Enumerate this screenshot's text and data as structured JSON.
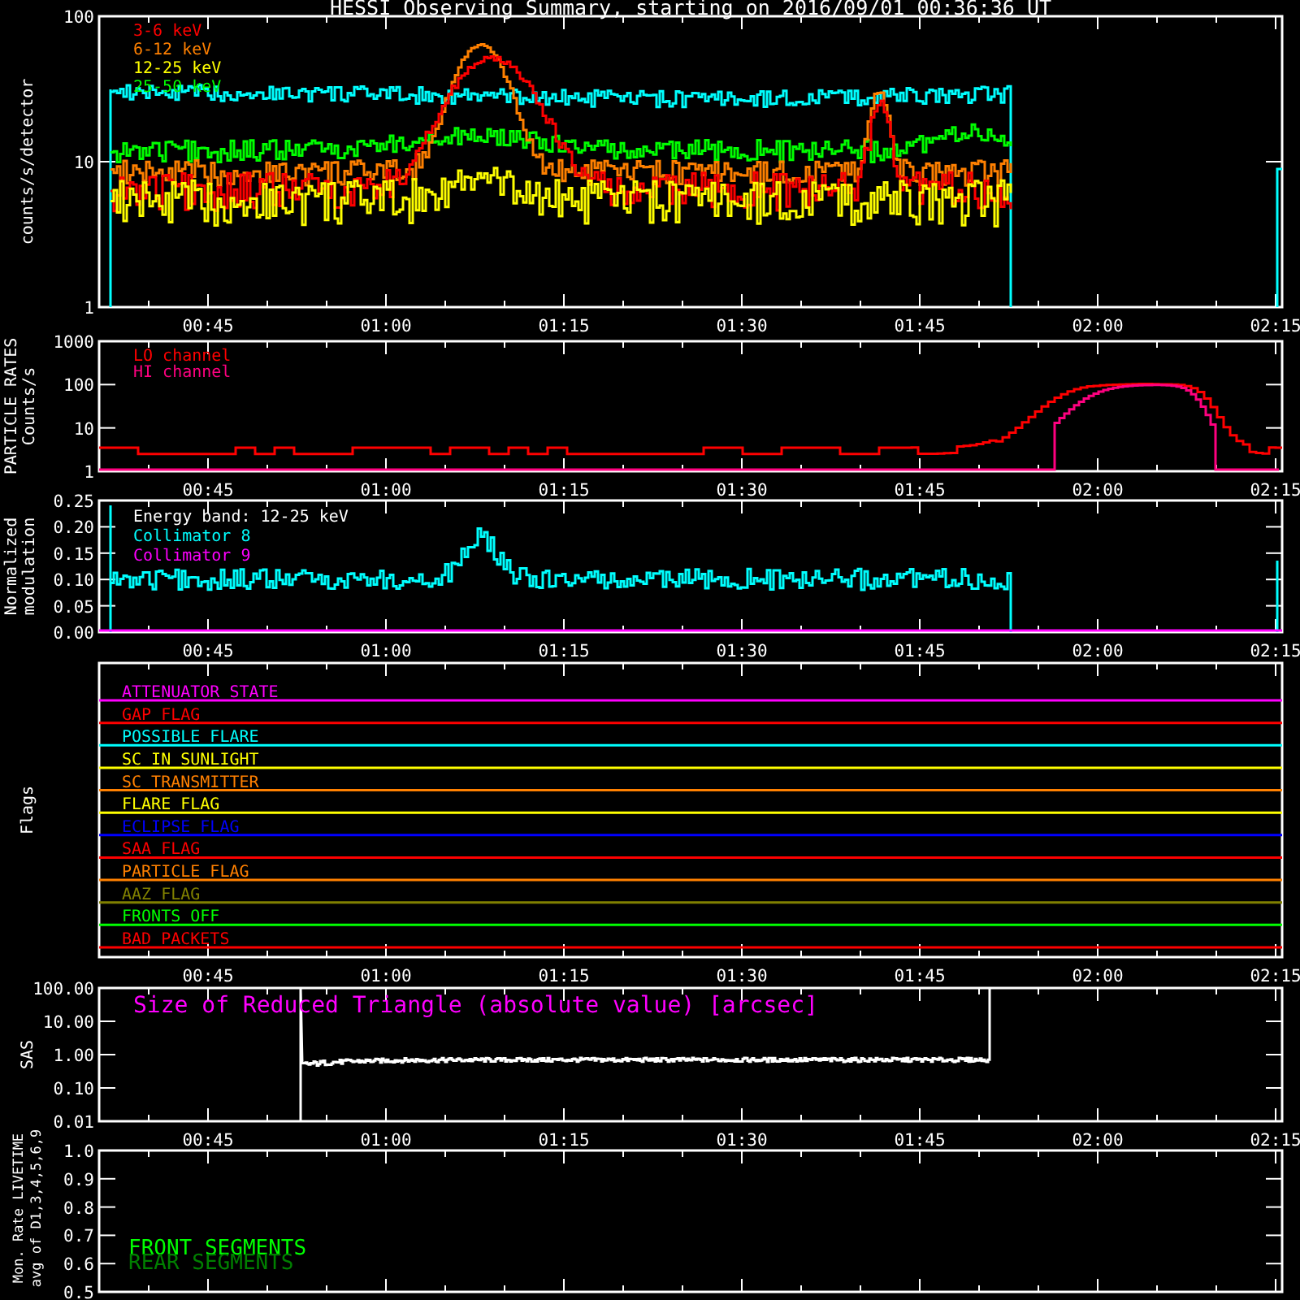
{
  "title": "HESSI Observing Summary, starting on 2016/09/01 00:36:36 UT",
  "panels": [
    {
      "kind": "counts",
      "y_title": [
        "counts/s/detector"
      ],
      "y_ticks": [
        "100",
        "10",
        "1"
      ],
      "x_ticks": [
        "00:45",
        "01:00",
        "01:15",
        "01:30",
        "01:45",
        "02:00",
        "02:15"
      ],
      "legend": [
        {
          "label": "3-6 keV",
          "color": "#ff0000"
        },
        {
          "label": "6-12 keV",
          "color": "#ff8000"
        },
        {
          "label": "12-25 keV",
          "color": "#ffff00"
        },
        {
          "label": "25-50 keV",
          "color": "#00ff00"
        }
      ]
    },
    {
      "kind": "particle",
      "y_title": [
        "PARTICLE RATES",
        "Counts/s"
      ],
      "y_ticks": [
        "1000",
        "100",
        "10",
        "1"
      ],
      "x_ticks": [
        "00:45",
        "01:00",
        "01:15",
        "01:30",
        "01:45",
        "02:00",
        "02:15"
      ],
      "legend": [
        {
          "label": "LO channel",
          "color": "#ff0000"
        },
        {
          "label": "HI channel",
          "color": "#ff0080"
        }
      ]
    },
    {
      "kind": "modulation",
      "y_title": [
        "Normalized",
        "modulation"
      ],
      "y_ticks": [
        "0.25",
        "0.20",
        "0.15",
        "0.10",
        "0.05",
        "0.00"
      ],
      "x_ticks": [
        "00:45",
        "01:00",
        "01:15",
        "01:30",
        "01:45",
        "02:00",
        "02:15"
      ],
      "legend": [
        {
          "label": "Energy band: 12-25 keV",
          "color": "#ffffff"
        },
        {
          "label": "Collimator 8",
          "color": "#00ffff"
        },
        {
          "label": "Collimator 9",
          "color": "#ff00ff"
        }
      ]
    },
    {
      "kind": "flags",
      "y_title": [
        "Flags"
      ],
      "x_ticks": [
        "00:45",
        "01:00",
        "01:15",
        "01:30",
        "01:45",
        "02:00",
        "02:15"
      ],
      "flags": [
        {
          "label": "ATTENUATOR STATE",
          "color": "#ff00ff"
        },
        {
          "label": "GAP FLAG",
          "color": "#ff0000"
        },
        {
          "label": "POSSIBLE FLARE",
          "color": "#00ffff"
        },
        {
          "label": "SC IN SUNLIGHT",
          "color": "#ffff00"
        },
        {
          "label": "SC TRANSMITTER",
          "color": "#ff8000"
        },
        {
          "label": "FLARE FLAG",
          "color": "#ffff00"
        },
        {
          "label": "ECLIPSE FLAG",
          "color": "#0000ff"
        },
        {
          "label": "SAA FLAG",
          "color": "#ff0000"
        },
        {
          "label": "PARTICLE FLAG",
          "color": "#ff8000"
        },
        {
          "label": "AAZ FLAG",
          "color": "#808000"
        },
        {
          "label": "FRONTS OFF",
          "color": "#00ff00"
        },
        {
          "label": "BAD PACKETS",
          "color": "#ff0000"
        }
      ]
    },
    {
      "kind": "sas",
      "y_title": [
        "SAS"
      ],
      "y_ticks": [
        "100.00",
        "10.00",
        "1.00",
        "0.10",
        "0.01"
      ],
      "x_ticks": [
        "00:45",
        "01:00",
        "01:15",
        "01:30",
        "01:45",
        "02:00",
        "02:15"
      ],
      "legend": [
        {
          "label": "Size of Reduced Triangle (absolute value) [arcsec]",
          "color": "#ff00ff"
        }
      ]
    },
    {
      "kind": "livetime",
      "y_title": [
        "Mon. Rate LIVETIME",
        "avg of D1,3,4,5,6,9"
      ],
      "y_ticks": [
        "1.0",
        "0.9",
        "0.8",
        "0.7",
        "0.6",
        "0.5"
      ],
      "legend": [
        {
          "label": "FRONT SEGMENTS",
          "color": "#00ff00"
        },
        {
          "label": "REAR SEGMENTS",
          "color": "#008000"
        }
      ]
    }
  ]
}
